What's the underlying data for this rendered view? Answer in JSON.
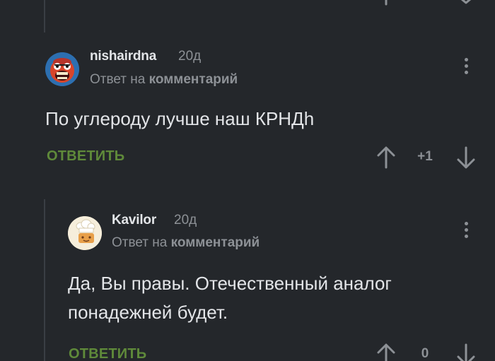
{
  "comments": [
    {
      "username": "nishairdna",
      "time": "20д",
      "reply_prefix": "Ответ на",
      "reply_target": "комментарий",
      "text": "По углероду лучше наш КРНДh",
      "reply_label": "ОТВЕТИТЬ",
      "rating": "+1"
    },
    {
      "username": "Kavilor",
      "time": "20д",
      "reply_prefix": "Ответ на",
      "reply_target": "комментарий",
      "text_lines": [
        "Да, Вы правы. Отечественный аналог",
        "понадежней будет."
      ],
      "reply_label": "ОТВЕТИТЬ",
      "rating": "0"
    }
  ]
}
